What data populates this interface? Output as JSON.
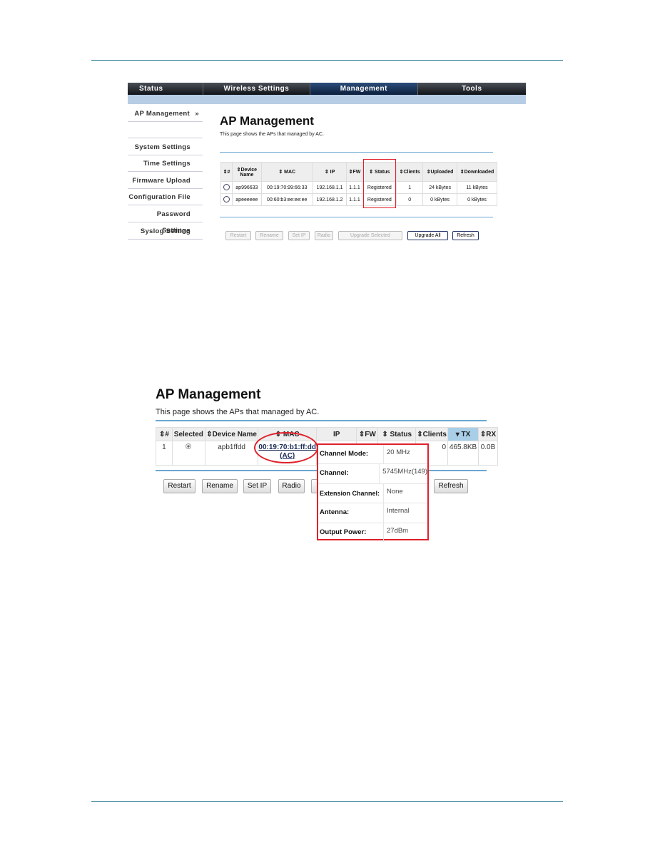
{
  "screenshot1": {
    "nav": [
      "Status",
      "Wireless Settings",
      "Management",
      "Tools"
    ],
    "nav_active": "Management",
    "sidebar": [
      "AP Management",
      "",
      "System Settings",
      "Time Settings",
      "Firmware Upload",
      "Configuration File",
      "Password Settings",
      "Syslog Setting"
    ],
    "sidebar_active_marker": "»",
    "title": "AP Management",
    "subtitle": "This page shows the APs that managed by AC.",
    "headers": [
      "⇕#",
      "⇕Device Name",
      "⇕ MAC",
      "⇕ IP",
      "⇕FW",
      "⇕ Status",
      "⇕Clients",
      "⇕Uploaded",
      "⇕Downloaded"
    ],
    "rows": [
      [
        "",
        "ap996633",
        "00:19:70:99:66:33",
        "192.168.1.1",
        "1.1.1",
        "Registered",
        "1",
        "24 kBytes",
        "11 kBytes"
      ],
      [
        "",
        "apeeeeee",
        "00:60:b3:ee:ee:ee",
        "192.168.1.2",
        "1.1.1",
        "Registered",
        "0",
        "0 kBytes",
        "0 kBytes"
      ]
    ],
    "buttons": [
      {
        "label": "Restart",
        "enabled": false
      },
      {
        "label": "Rename",
        "enabled": false
      },
      {
        "label": "Set IP",
        "enabled": false
      },
      {
        "label": "Radio",
        "enabled": false
      },
      {
        "label": "Upgrade Selected",
        "enabled": false
      },
      {
        "label": "Upgrade All",
        "enabled": true
      },
      {
        "label": "Refresh",
        "enabled": true
      }
    ],
    "highlight_color": "#e0202a"
  },
  "screenshot2": {
    "title": "AP Management",
    "subtitle": "This page shows the APs that managed by AC.",
    "headers": [
      "⇕#",
      "Selected",
      "⇕Device Name",
      "⇕ MAC",
      "IP",
      "⇕FW",
      "⇕ Status",
      "⇕Clients",
      "▾ TX",
      "⇕RX"
    ],
    "row": {
      "index": "1",
      "device_name": "apb1ffdd",
      "mac": "00:19:70:b1:ff:dd",
      "mac_note": "(AC)",
      "clients": "0",
      "tx": "465.8KB",
      "rx": "0.0B"
    },
    "buttons": [
      "Restart",
      "Rename",
      "Set IP",
      "Radio",
      "Refresh"
    ],
    "popup": [
      {
        "label": "Channel Mode:",
        "value": "20 MHz"
      },
      {
        "label": "Channel:",
        "value": "5745MHz(149)"
      },
      {
        "label": "Extension Channel:",
        "value": "None"
      },
      {
        "label": "Antenna:",
        "value": "Internal"
      },
      {
        "label": "Output Power:",
        "value": "27dBm"
      }
    ],
    "highlight_color": "#e0202a"
  }
}
